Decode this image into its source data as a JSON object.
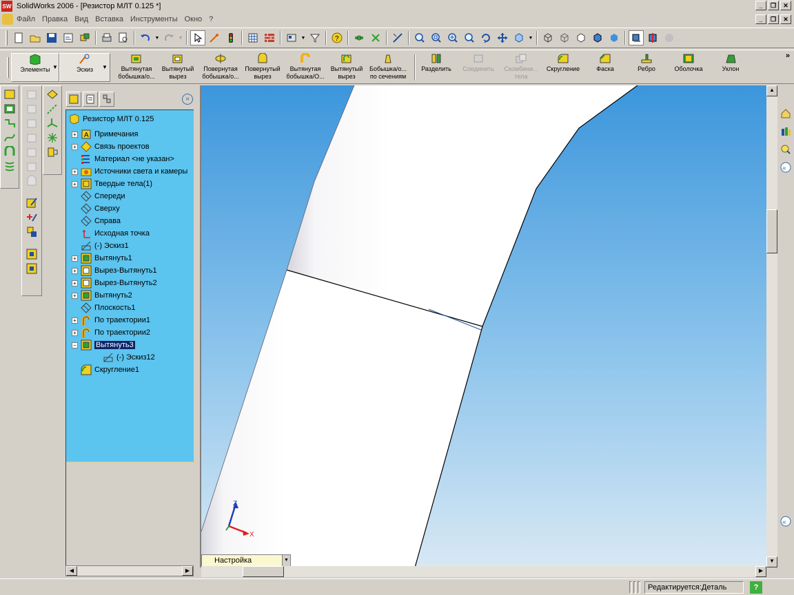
{
  "window": {
    "title": "SolidWorks 2006 - [Резистор МЛТ 0.125 *]",
    "logo_text": "SW"
  },
  "menubar": {
    "items": [
      "Файл",
      "Правка",
      "Вид",
      "Вставка",
      "Инструменты",
      "Окно",
      "?"
    ]
  },
  "toolbar2": {
    "tabs": [
      {
        "label": "Элементы"
      },
      {
        "label": "Эскиз"
      }
    ],
    "buttons": [
      {
        "label": "Вытянутая бобышка/о...",
        "icon": "extruded-boss-icon",
        "disabled": false
      },
      {
        "label": "Вытянутый вырез",
        "icon": "extruded-cut-icon",
        "disabled": false
      },
      {
        "label": "Повернутая бобышка/о...",
        "icon": "revolved-boss-icon",
        "disabled": false
      },
      {
        "label": "Повернутый вырез",
        "icon": "revolved-cut-icon",
        "disabled": false
      },
      {
        "label": "Вытянутая бобышка/О...",
        "icon": "swept-boss-icon",
        "disabled": false
      },
      {
        "label": "Вытянутый вырез",
        "icon": "swept-cut-icon",
        "disabled": false
      },
      {
        "label": "Бобышка/о... по сечениям",
        "icon": "loft-icon",
        "disabled": false
      },
      {
        "label": "Разделить",
        "icon": "split-icon",
        "disabled": false
      },
      {
        "label": "Соединить",
        "icon": "join-icon",
        "disabled": true
      },
      {
        "label": "Скомбини... тела",
        "icon": "combine-icon",
        "disabled": true
      },
      {
        "label": "Скругление",
        "icon": "fillet-icon",
        "disabled": false
      },
      {
        "label": "Фаска",
        "icon": "chamfer-icon",
        "disabled": false
      },
      {
        "label": "Ребро",
        "icon": "rib-icon",
        "disabled": false
      },
      {
        "label": "Оболочка",
        "icon": "shell-icon",
        "disabled": false
      },
      {
        "label": "Уклон",
        "icon": "draft-icon",
        "disabled": false
      }
    ]
  },
  "feature_tree": {
    "root": "Резистор МЛТ 0.125",
    "items": [
      {
        "label": "Примечания",
        "expander": "+",
        "icon": "annotations-icon",
        "indent": 1
      },
      {
        "label": "Связь проектов",
        "expander": "+",
        "icon": "design-binder-icon",
        "indent": 1
      },
      {
        "label": "Материал <не указан>",
        "expander": "",
        "icon": "material-icon",
        "indent": 1
      },
      {
        "label": "Источники света и камеры",
        "expander": "+",
        "icon": "lights-icon",
        "indent": 1
      },
      {
        "label": "Твердые тела(1)",
        "expander": "+",
        "icon": "solid-bodies-icon",
        "indent": 1
      },
      {
        "label": "Спереди",
        "expander": "",
        "icon": "plane-icon",
        "indent": 1
      },
      {
        "label": "Сверху",
        "expander": "",
        "icon": "plane-icon",
        "indent": 1
      },
      {
        "label": "Справа",
        "expander": "",
        "icon": "plane-icon",
        "indent": 1
      },
      {
        "label": "Исходная точка",
        "expander": "",
        "icon": "origin-icon",
        "indent": 1
      },
      {
        "label": "(-) Эскиз1",
        "expander": "",
        "icon": "sketch-icon",
        "indent": 1
      },
      {
        "label": "Вытянуть1",
        "expander": "+",
        "icon": "extrude-icon",
        "indent": 1
      },
      {
        "label": "Вырез-Вытянуть1",
        "expander": "+",
        "icon": "cut-extrude-icon",
        "indent": 1
      },
      {
        "label": "Вырез-Вытянуть2",
        "expander": "+",
        "icon": "cut-extrude-icon",
        "indent": 1
      },
      {
        "label": "Вытянуть2",
        "expander": "+",
        "icon": "extrude-icon",
        "indent": 1
      },
      {
        "label": "Плоскость1",
        "expander": "",
        "icon": "plane-icon",
        "indent": 1
      },
      {
        "label": "По траектории1",
        "expander": "+",
        "icon": "sweep-icon",
        "indent": 1
      },
      {
        "label": "По траектории2",
        "expander": "+",
        "icon": "sweep-icon",
        "indent": 1
      },
      {
        "label": "Вытянуть3",
        "expander": "−",
        "icon": "extrude-icon",
        "indent": 1,
        "selected": true
      },
      {
        "label": "(-) Эскиз12",
        "expander": "",
        "icon": "sketch-icon",
        "indent": 2
      },
      {
        "label": "Скругление1",
        "expander": "",
        "icon": "fillet-icon",
        "indent": 1
      }
    ]
  },
  "viewport": {
    "triad": {
      "z": "Z",
      "x": "X"
    },
    "colors": {
      "bg_top": "#3c96dc",
      "bg_bottom": "#d8e8f4",
      "part": "#ffffff"
    }
  },
  "configuration": {
    "value": "Настройка"
  },
  "statusbar": {
    "text": "Редактируется:Деталь",
    "help": "?"
  }
}
